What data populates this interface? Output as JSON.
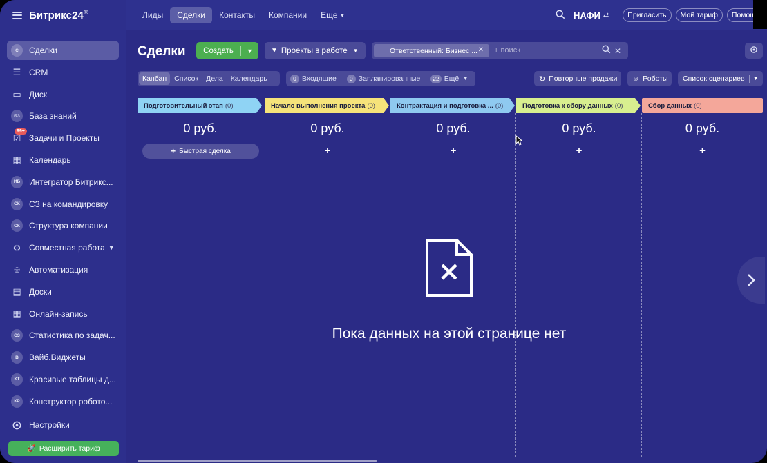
{
  "app": {
    "logo": "Битрикс24",
    "logo_mark": "©"
  },
  "sidebar": {
    "items": [
      {
        "label": "Сделки",
        "icon": "avatar",
        "abbr": "С",
        "active": true
      },
      {
        "label": "CRM",
        "icon": "crm-icon",
        "glyph": "☰"
      },
      {
        "label": "Диск",
        "icon": "disk-icon",
        "glyph": "▭"
      },
      {
        "label": "База знаний",
        "icon": "avatar",
        "abbr": "БЗ"
      },
      {
        "label": "Задачи и Проекты",
        "icon": "tasks-icon",
        "glyph": "☑",
        "badge": "99+"
      },
      {
        "label": "Календарь",
        "icon": "calendar-icon",
        "glyph": "▦"
      },
      {
        "label": "Интегратор Битрикс...",
        "icon": "avatar",
        "abbr": "ИБ"
      },
      {
        "label": "СЗ на командировку",
        "icon": "avatar",
        "abbr": "СК"
      },
      {
        "label": "Структура компании",
        "icon": "avatar",
        "abbr": "СК"
      },
      {
        "label": "Совместная работа",
        "icon": "collab-icon",
        "glyph": "⚙",
        "chevron": true
      },
      {
        "label": "Автоматизация",
        "icon": "robot-icon",
        "glyph": "☺"
      },
      {
        "label": "Доски",
        "icon": "boards-icon",
        "glyph": "▤"
      },
      {
        "label": "Онлайн-запись",
        "icon": "booking-icon",
        "glyph": "▦"
      },
      {
        "label": "Статистика по задач...",
        "icon": "avatar",
        "abbr": "СЗ"
      },
      {
        "label": "Вайб.Виджеты",
        "icon": "avatar",
        "abbr": "В"
      },
      {
        "label": "Красивые таблицы д...",
        "icon": "avatar",
        "abbr": "КТ"
      },
      {
        "label": "Конструктор робото...",
        "icon": "avatar",
        "abbr": "КР"
      }
    ],
    "settings_label": "Настройки",
    "upgrade_label": "Расширить тариф"
  },
  "topbar": {
    "tabs": [
      {
        "label": "Лиды",
        "active": false
      },
      {
        "label": "Сделки",
        "active": true
      },
      {
        "label": "Контакты",
        "active": false
      },
      {
        "label": "Компании",
        "active": false
      },
      {
        "label": "Еще",
        "active": false,
        "chevron": true
      }
    ],
    "company": "НАФИ",
    "invite_label": "Пригласить",
    "plan_label": "Мой тариф",
    "help_label": "Помощь"
  },
  "toolbar": {
    "title": "Сделки",
    "create_label": "Создать",
    "pipeline_label": "Проекты в работе",
    "filter_tag": "Ответственный: Бизнес ...",
    "filter_placeholder": "+ поиск"
  },
  "views": {
    "items": [
      {
        "label": "Канбан",
        "active": true
      },
      {
        "label": "Список",
        "active": false
      },
      {
        "label": "Дела",
        "active": false
      },
      {
        "label": "Календарь",
        "active": false
      }
    ]
  },
  "counters": {
    "incoming_count": "0",
    "incoming_label": "Входящие",
    "planned_count": "0",
    "planned_label": "Запланированные",
    "more_count": "22",
    "more_label": "Ещё"
  },
  "actions": {
    "repeat_sales": "Повторные продажи",
    "robots": "Роботы",
    "scenarios": "Список сценариев"
  },
  "kanban": {
    "columns": [
      {
        "title": "Подготовительный этап",
        "count": "(0)",
        "sum": "0 руб.",
        "color": "#8fd3f4",
        "quick_deal": "Быстрая сделка"
      },
      {
        "title": "Начало выполнения проекта",
        "count": "(0)",
        "sum": "0 руб.",
        "color": "#f6e37a"
      },
      {
        "title": "Контрактация и подготовка ...",
        "count": "(0)",
        "sum": "0 руб.",
        "color": "#8fc9f0"
      },
      {
        "title": "Подготовка к сбору данных",
        "count": "(0)",
        "sum": "0 руб.",
        "color": "#d8ef8f"
      },
      {
        "title": "Сбор данных",
        "count": "(0)",
        "sum": "0 руб.",
        "color": "#f4a79a"
      }
    ],
    "plus": "+",
    "empty_text": "Пока данных на этой странице нет"
  }
}
